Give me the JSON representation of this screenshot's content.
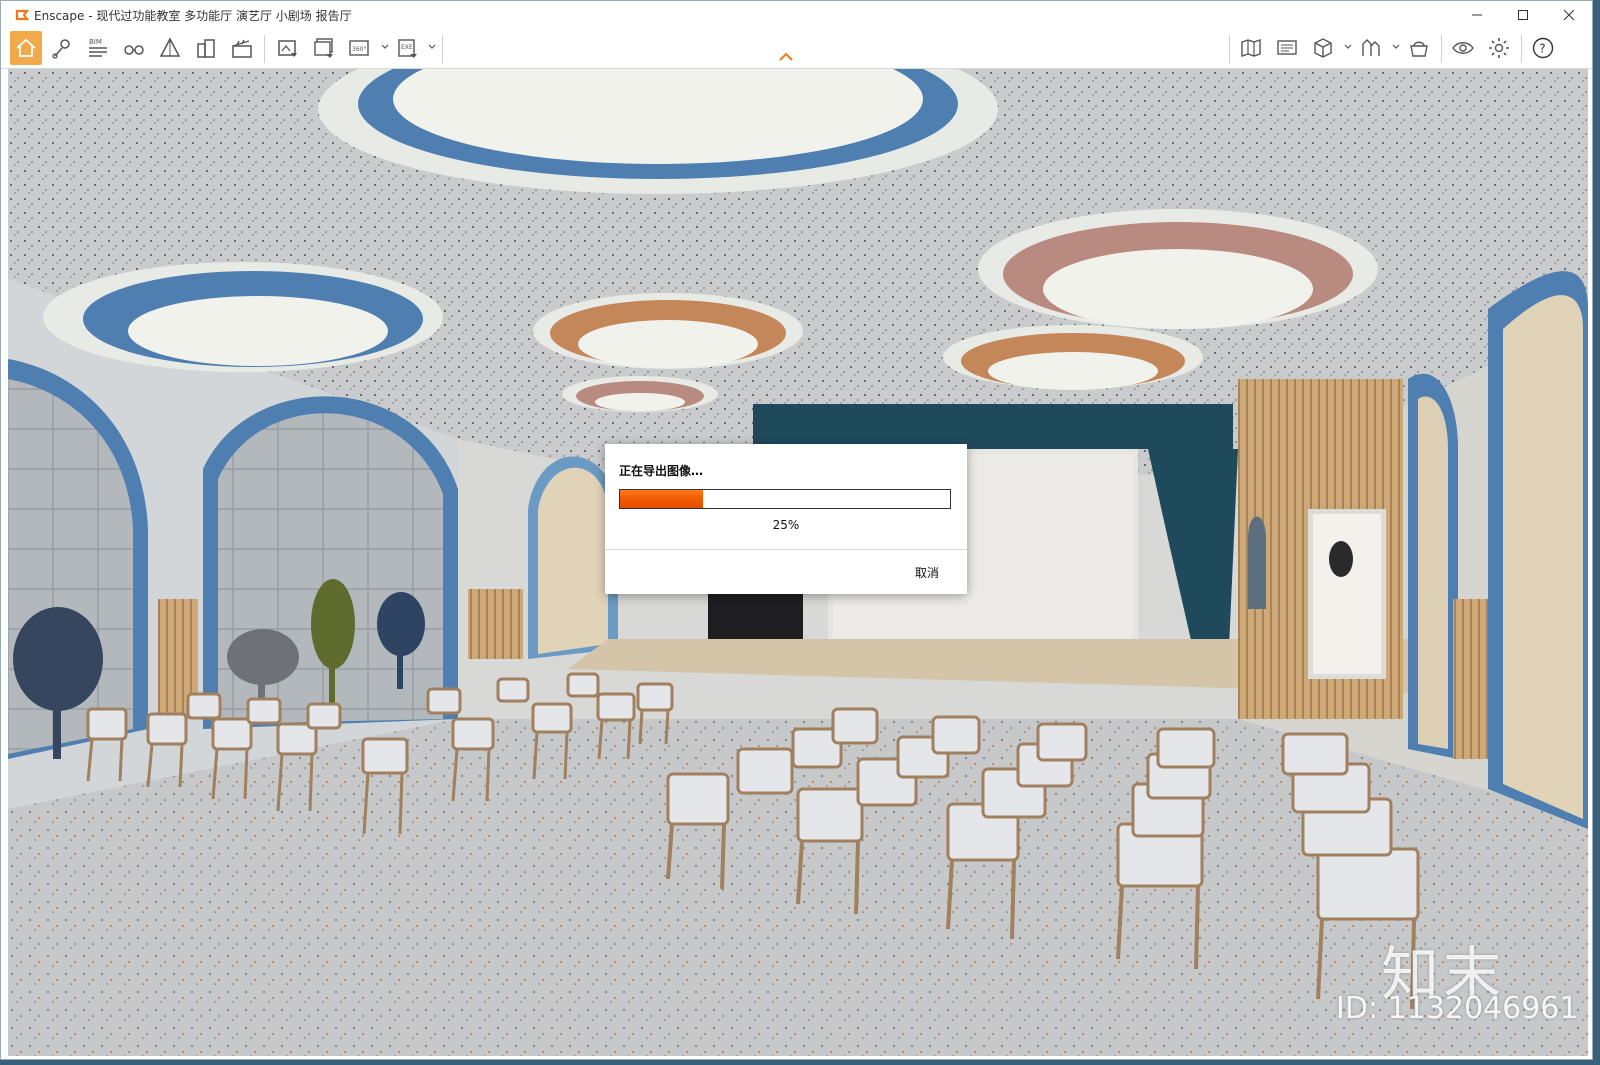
{
  "window": {
    "app_name": "Enscape",
    "title": "Enscape - 现代过功能教室 多功能厅 演艺厅 小剧场 报告厅"
  },
  "toolbar": {
    "left_buttons": [
      "home-icon",
      "location-pin-icon",
      "bim-icon",
      "binoculars-icon",
      "perspective-icon",
      "buildings-icon",
      "clapperboard-icon",
      "render-image-icon",
      "batch-render-icon",
      "panorama-360-icon",
      "export-exe-icon"
    ],
    "right_buttons": [
      "map-icon",
      "screen-icon",
      "cube-view-icon",
      "section-icon",
      "asset-library-icon",
      "visual-settings-icon",
      "settings-gear-icon",
      "help-icon"
    ],
    "bim_label": "BIM",
    "pano_label": "360°",
    "exe_label": "EXE"
  },
  "dialog": {
    "title": "正在导出图像…",
    "progress": 25,
    "progress_text": "25%",
    "cancel_label": "取消"
  },
  "watermark": {
    "logo": "知末",
    "id_text": "ID: 1132046961"
  },
  "colors": {
    "accent": "#f2a94a",
    "progress": "#f05a00",
    "ceiling_blue": "#4e7fb0",
    "ceiling_rose": "#b98a80",
    "ceiling_amber": "#c4875a",
    "curtain": "#1f4a5c"
  }
}
